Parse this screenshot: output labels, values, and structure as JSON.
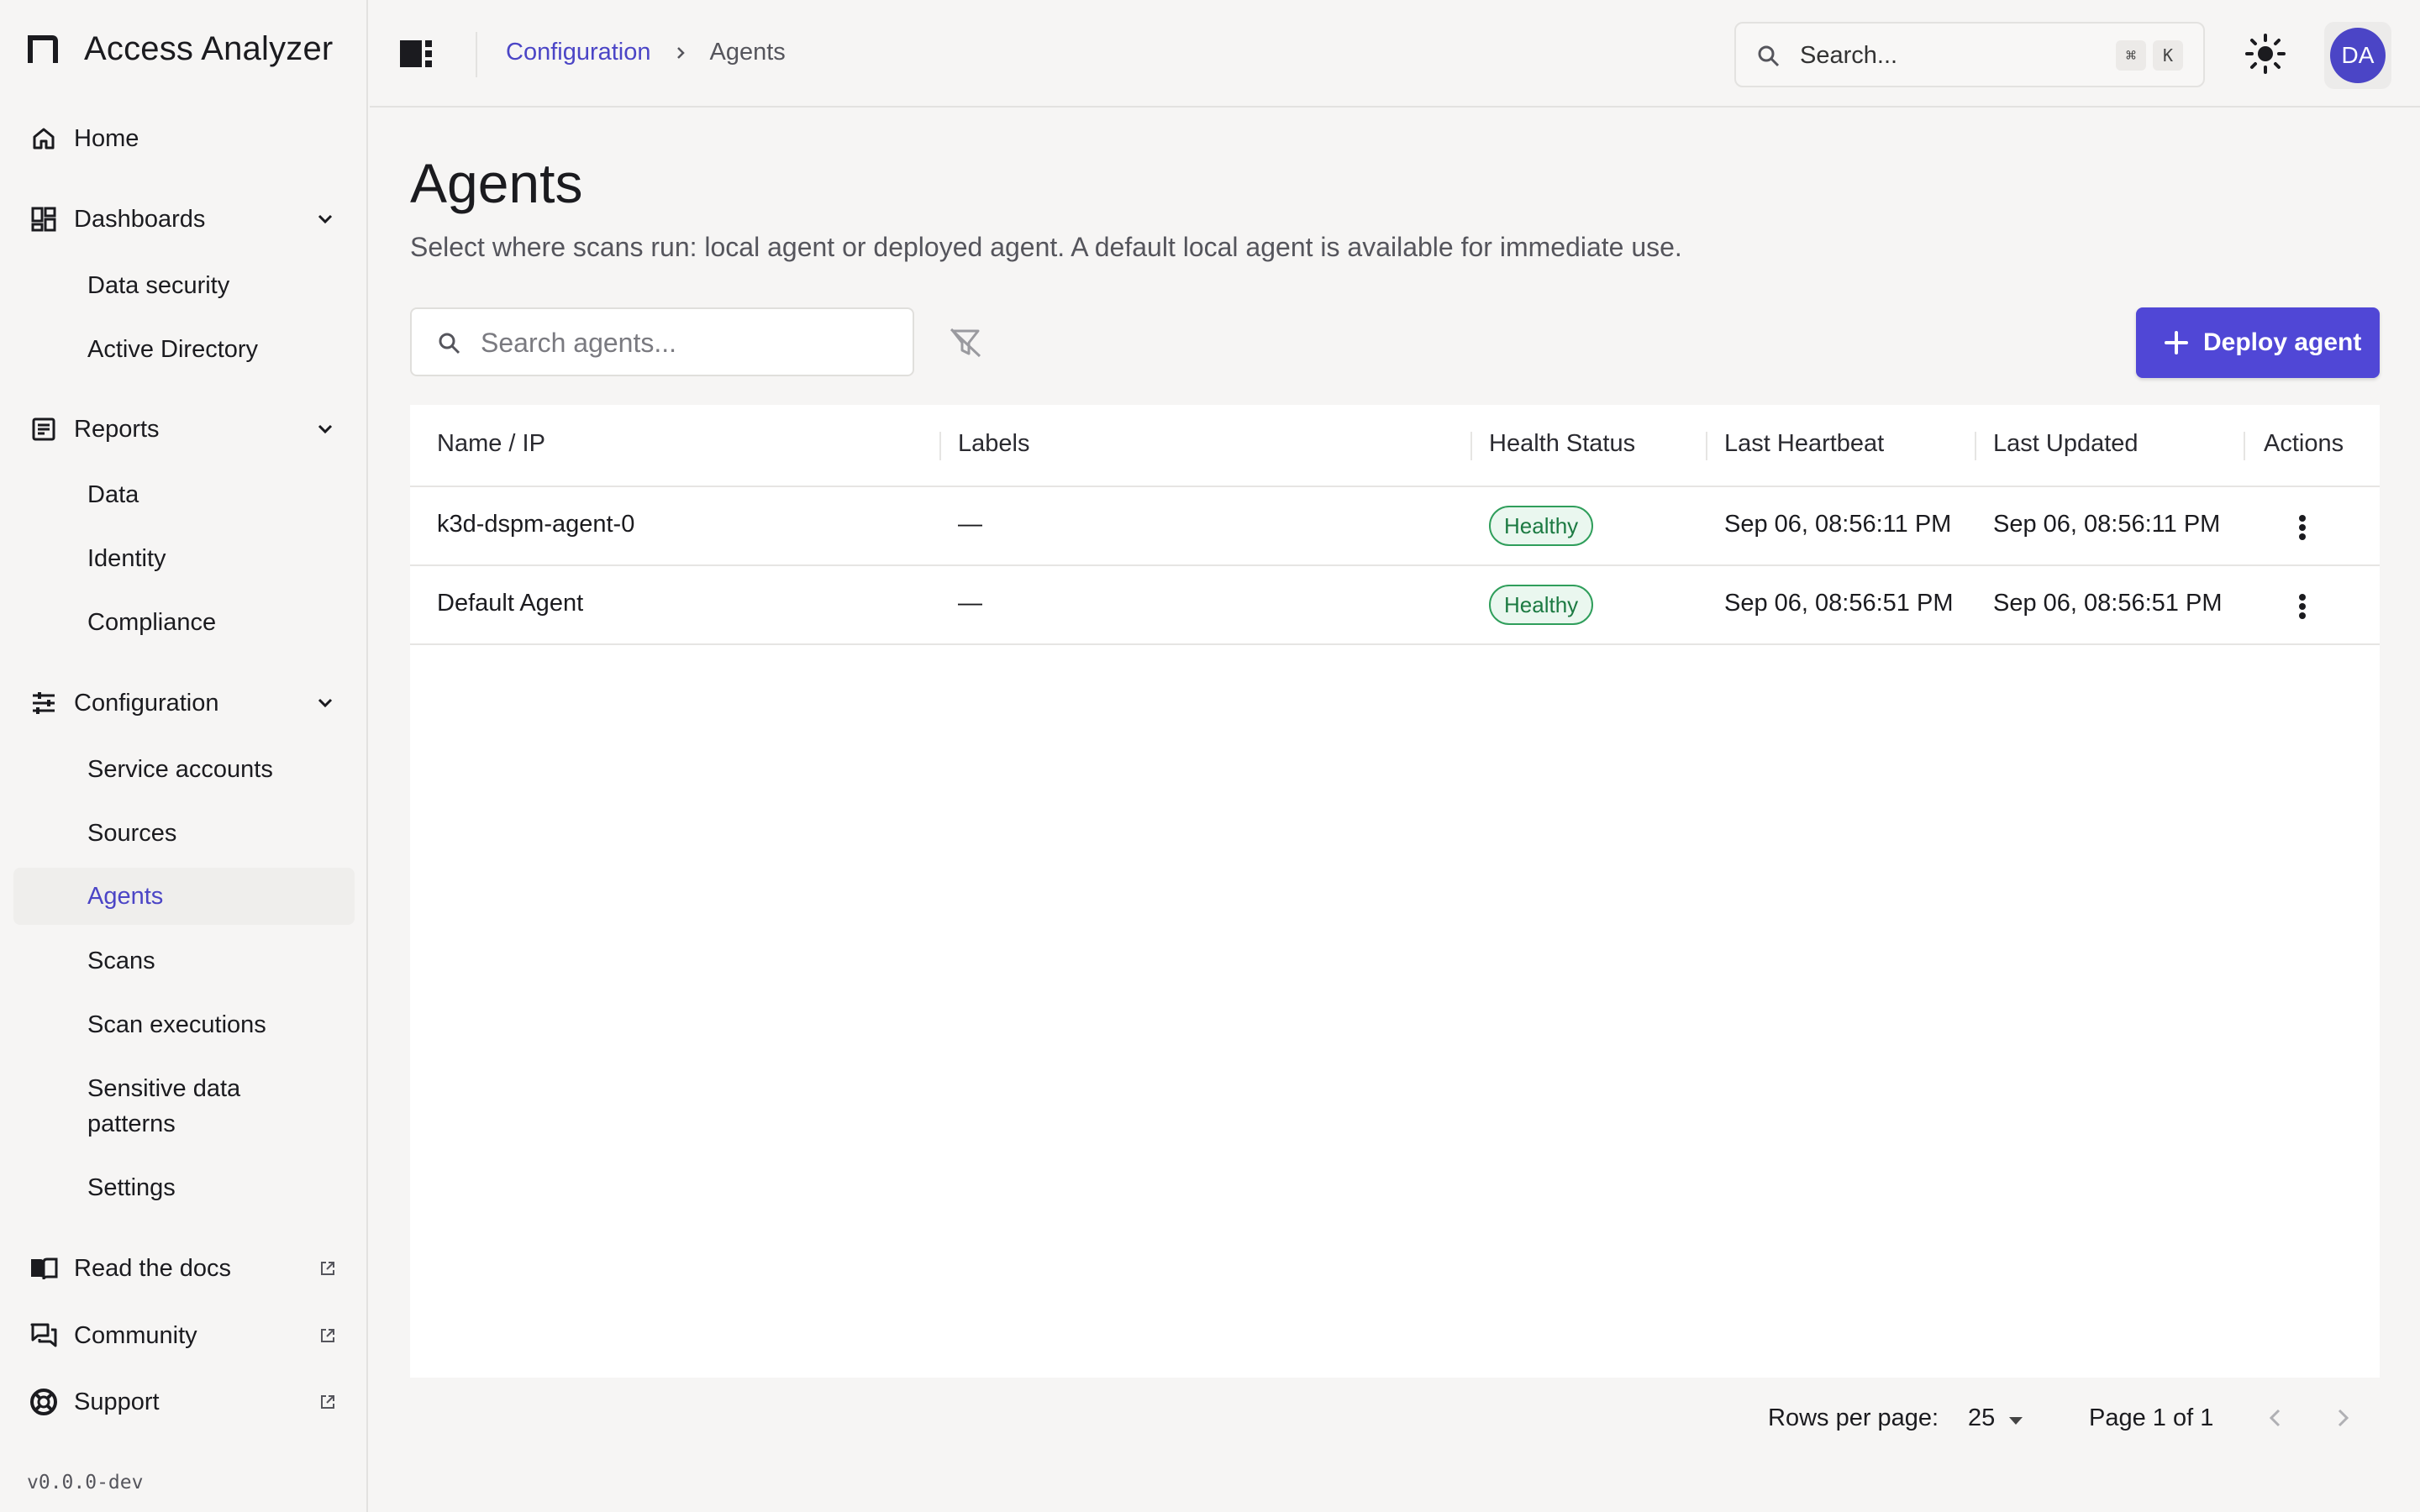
{
  "app": {
    "title": "Access Analyzer",
    "version": "v0.0.0-dev"
  },
  "sidebar": {
    "home": "Home",
    "dashboards": {
      "label": "Dashboards",
      "items": [
        "Data security",
        "Active Directory"
      ]
    },
    "reports": {
      "label": "Reports",
      "items": [
        "Data",
        "Identity",
        "Compliance"
      ]
    },
    "configuration": {
      "label": "Configuration",
      "items": [
        "Service accounts",
        "Sources",
        "Agents",
        "Scans",
        "Scan executions",
        "Sensitive data patterns",
        "Settings"
      ]
    },
    "links": [
      "Read the docs",
      "Community",
      "Support"
    ]
  },
  "topbar": {
    "breadcrumb": {
      "parent": "Configuration",
      "current": "Agents"
    },
    "search_placeholder": "Search...",
    "shortcut_keys": [
      "⌘",
      "K"
    ],
    "avatar_initials": "DA"
  },
  "page": {
    "title": "Agents",
    "description": "Select where scans run: local agent or deployed agent. A default local agent is available for immediate use.",
    "search_placeholder": "Search agents...",
    "deploy_label": "Deploy agent"
  },
  "table": {
    "columns": [
      "Name / IP",
      "Labels",
      "Health Status",
      "Last Heartbeat",
      "Last Updated",
      "Actions"
    ],
    "rows": [
      {
        "name": "k3d-dspm-agent-0",
        "labels": "—",
        "health": "Healthy",
        "heartbeat": "Sep 06, 08:56:11 PM",
        "updated": "Sep 06, 08:56:11 PM"
      },
      {
        "name": "Default Agent",
        "labels": "—",
        "health": "Healthy",
        "heartbeat": "Sep 06, 08:56:51 PM",
        "updated": "Sep 06, 08:56:51 PM"
      }
    ]
  },
  "pagination": {
    "rows_label": "Rows per page:",
    "rows_value": "25",
    "page_label": "Page 1 of 1"
  },
  "colors": {
    "accent": "#4b45c6",
    "button": "#5047d6",
    "healthy": "#2f9e5b"
  }
}
